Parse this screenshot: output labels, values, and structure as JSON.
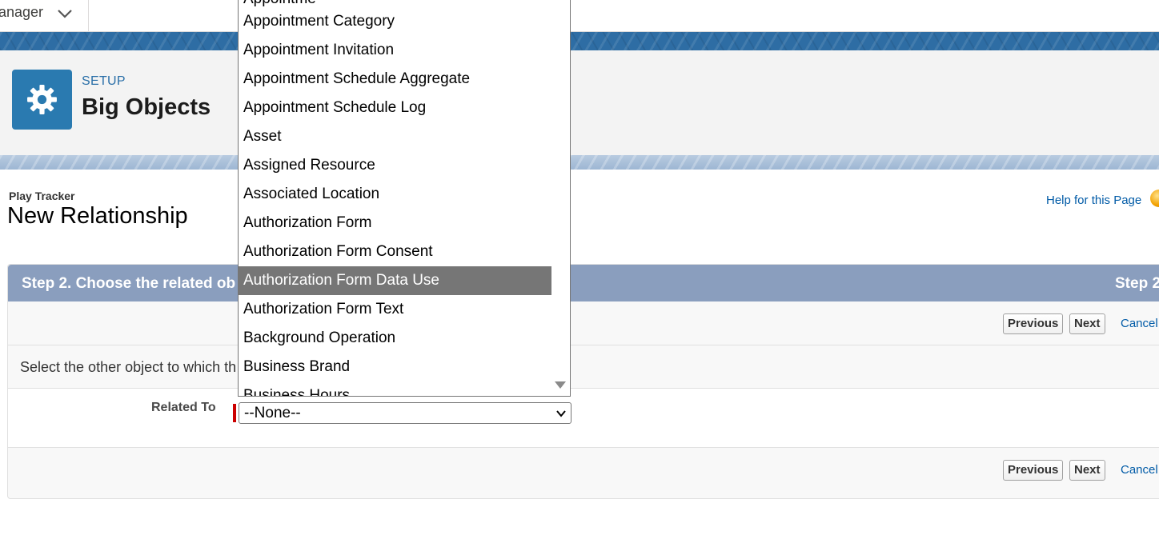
{
  "nav": {
    "app_label": "anager"
  },
  "setup": {
    "label": "SETUP",
    "title": "Big Objects"
  },
  "page": {
    "sub_title": "Play Tracker",
    "title": "New Relationship",
    "help_link": "Help for this Page"
  },
  "wizard": {
    "step_left": "Step 2. Choose the related ob",
    "step_right": "Step 2",
    "buttons": {
      "previous": "Previous",
      "next": "Next",
      "cancel": "Cancel"
    },
    "instruction": "Select the other object to which th",
    "field_label": "Related To",
    "select_value": "--None--"
  },
  "dropdown": {
    "items": [
      "Appointment Category",
      "Appointment Invitation",
      "Appointment Schedule Aggregate",
      "Appointment Schedule Log",
      "Asset",
      "Assigned Resource",
      "Associated Location",
      "Authorization Form",
      "Authorization Form Consent",
      "Authorization Form Data Use",
      "Authorization Form Text",
      "Background Operation",
      "Business Brand",
      "Business Hours"
    ],
    "highlighted": "Authorization Form Data Use"
  },
  "colors": {
    "step_bar": "#8a9ebe",
    "link": "#015ba7",
    "setup_icon": "#2a7ab0",
    "required": "#cc0000"
  },
  "icons": {
    "setup": "gear-icon",
    "app_menu": "chevron-down-icon",
    "help": "help-icon",
    "scroll": "triangle-down-icon"
  }
}
